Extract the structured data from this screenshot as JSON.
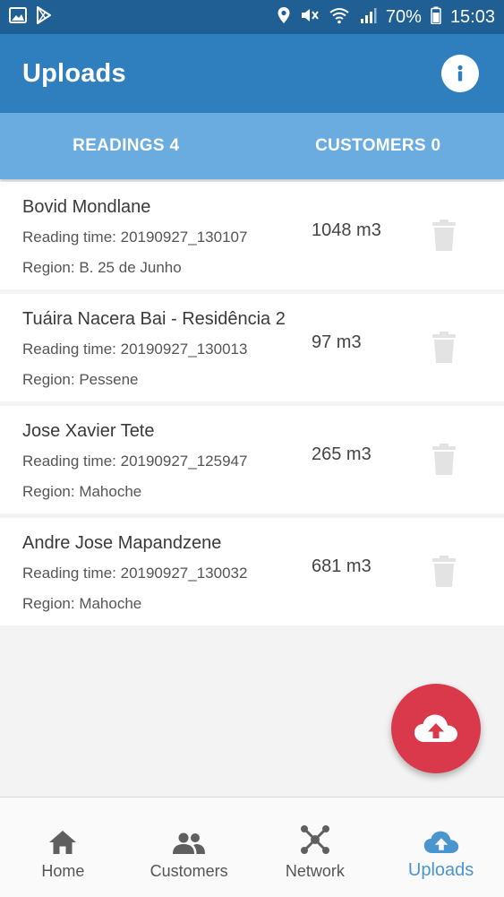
{
  "status_bar": {
    "battery": "70%",
    "time": "15:03"
  },
  "app_bar": {
    "title": "Uploads",
    "info_icon": "info-icon"
  },
  "tabs": [
    {
      "label": "READINGS 4",
      "selected": true
    },
    {
      "label": "CUSTOMERS 0",
      "selected": false
    }
  ],
  "readings": [
    {
      "name": "Bovid Mondlane",
      "time": "Reading time: 20190927_130107",
      "region": "Region: B. 25 de Junho",
      "volume": "1048 m3"
    },
    {
      "name": "Tuáira Nacera Bai - Residência 2",
      "time": "Reading time: 20190927_130013",
      "region": "Region: Pessene",
      "volume": "97 m3"
    },
    {
      "name": "Jose Xavier Tete",
      "time": "Reading time: 20190927_125947",
      "region": "Region: Mahoche",
      "volume": "265 m3"
    },
    {
      "name": "Andre Jose Mapandzene",
      "time": "Reading time: 20190927_130032",
      "region": "Region: Mahoche",
      "volume": "681 m3"
    }
  ],
  "fab": {
    "icon": "cloud-upload-icon"
  },
  "bottom_nav": [
    {
      "label": "Home",
      "icon": "home-icon"
    },
    {
      "label": "Customers",
      "icon": "people-icon"
    },
    {
      "label": "Network",
      "icon": "network-icon"
    },
    {
      "label": "Uploads",
      "icon": "cloud-upload-icon",
      "active": true
    }
  ],
  "colors": {
    "status_bar": "#1f5f93",
    "app_bar": "#2f7fbf",
    "tab_bar": "#6aace0",
    "fab": "#d9394a",
    "active_nav": "#4b95cf"
  }
}
